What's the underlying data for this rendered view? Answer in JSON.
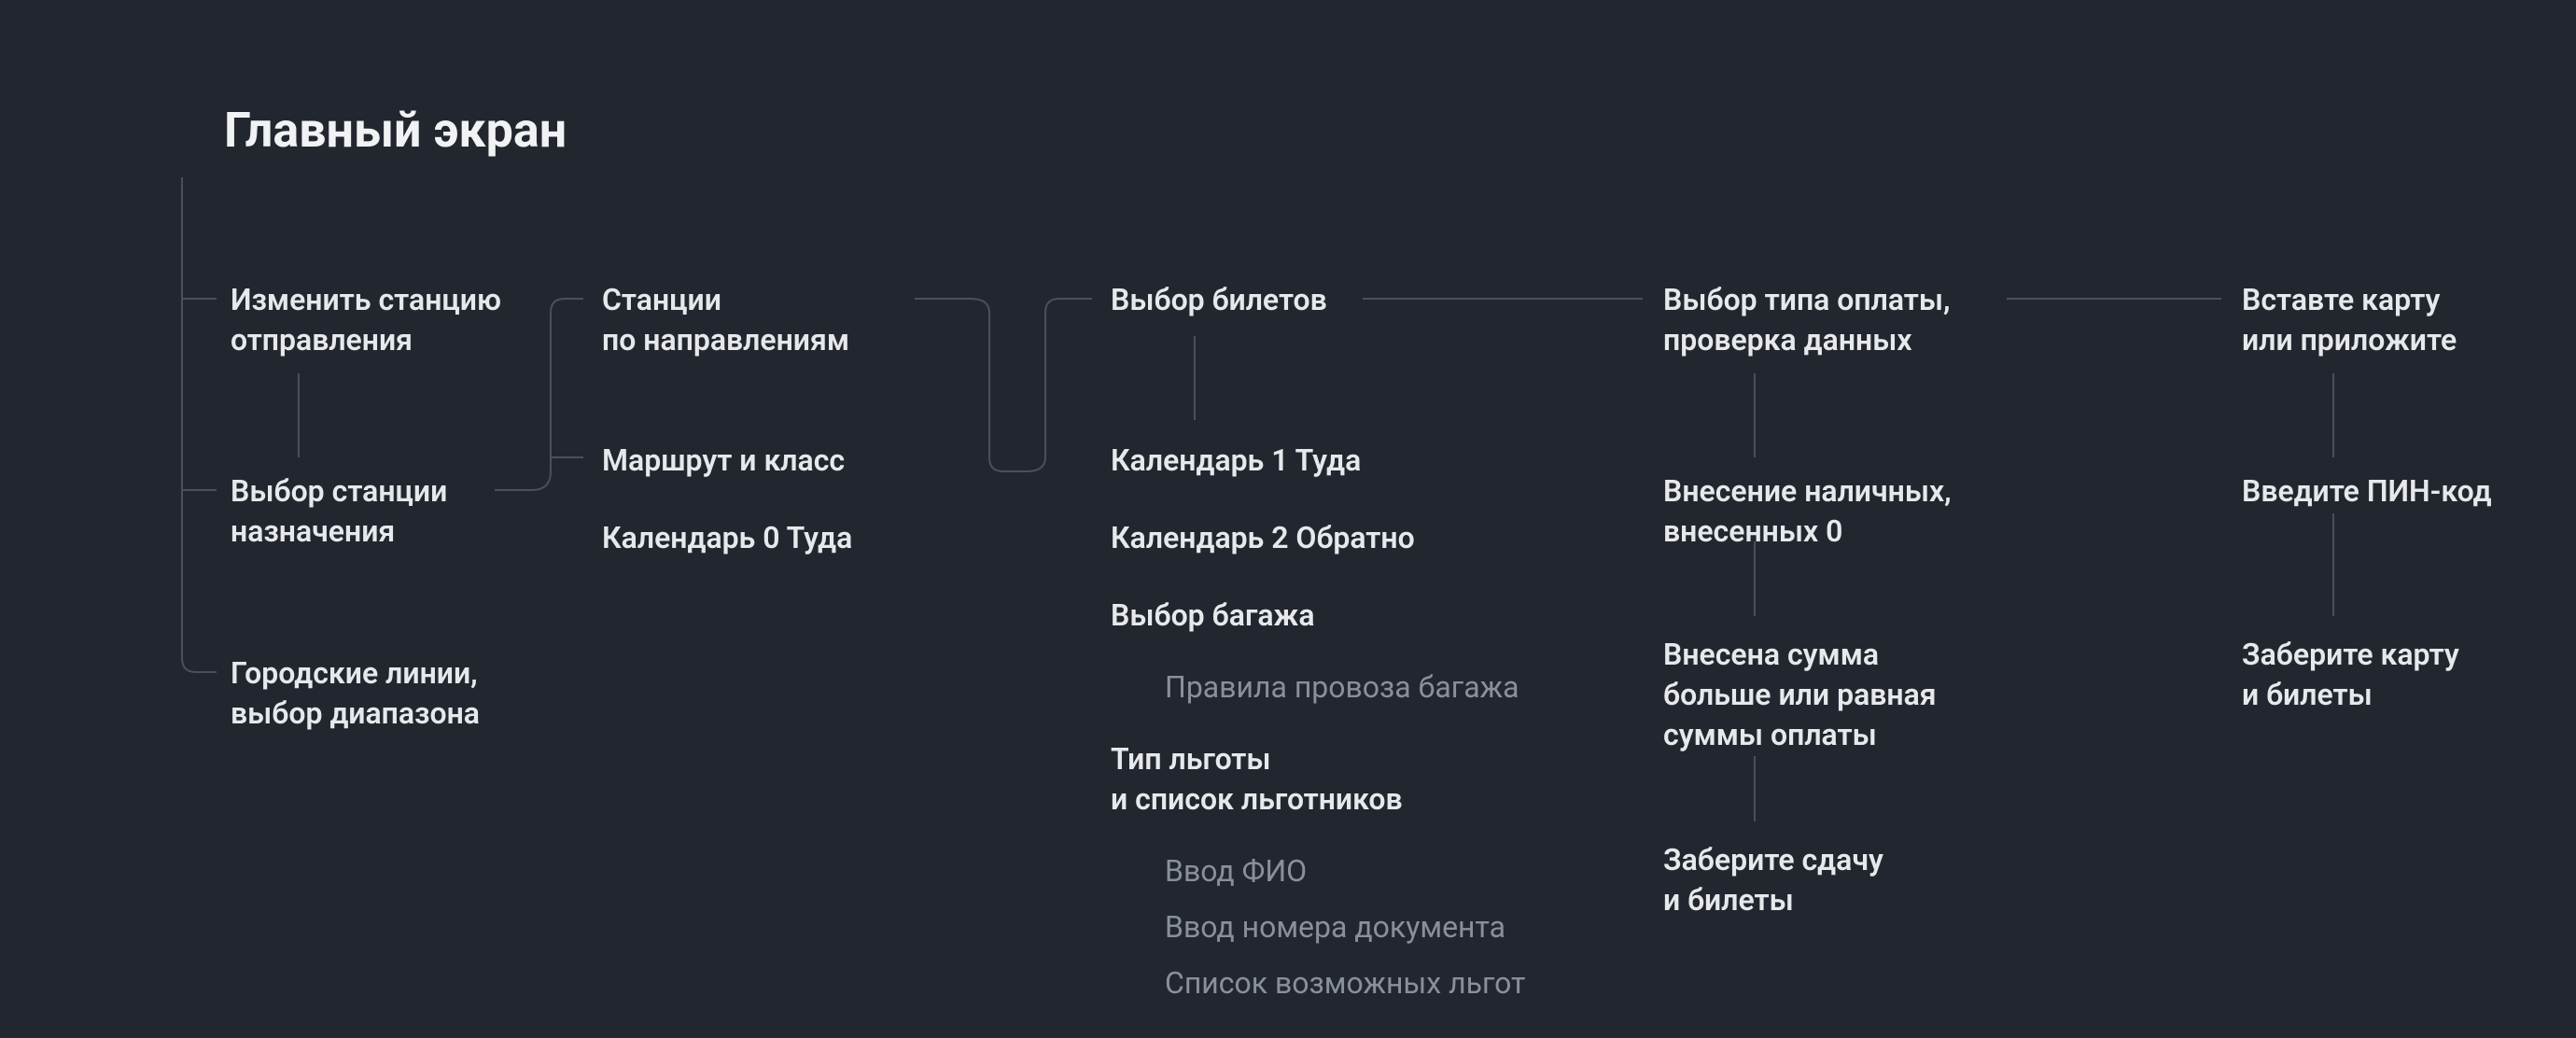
{
  "title": "Главный экран",
  "col1": {
    "change_station": "Изменить станцию\nотправления",
    "select_dest": "Выбор станции\nназначения",
    "city_lines": "Городские линии,\nвыбор диапазона"
  },
  "col2": {
    "stations_dir": "Станции\nпо направлениям",
    "route_class": "Маршрут и класс",
    "calendar0": "Календарь 0 Туда"
  },
  "col3": {
    "ticket_select": "Выбор билетов",
    "calendar1": "Календарь 1 Туда",
    "calendar2": "Календарь 2 Обратно",
    "luggage": "Выбор багажа",
    "luggage_rules": "Правила провоза багажа",
    "benefit_type": "Тип льготы\nи список льготников",
    "fio": "Ввод ФИО",
    "doc_num": "Ввод номера документа",
    "benefits_list": "Список возможных льгот"
  },
  "col4": {
    "payment_type": "Выбор типа оплаты,\nпроверка данных",
    "cash_input": "Внесение наличных,\nвнесенных 0",
    "amount_enough": "Внесена сумма\nбольше или равная\nсуммы оплаты",
    "take_change": "Заберите сдачу\nи билеты"
  },
  "col5": {
    "insert_card": "Вставте карту\nили приложите",
    "enter_pin": "Введите ПИН-код",
    "take_card": "Заберите карту\nи билеты"
  }
}
